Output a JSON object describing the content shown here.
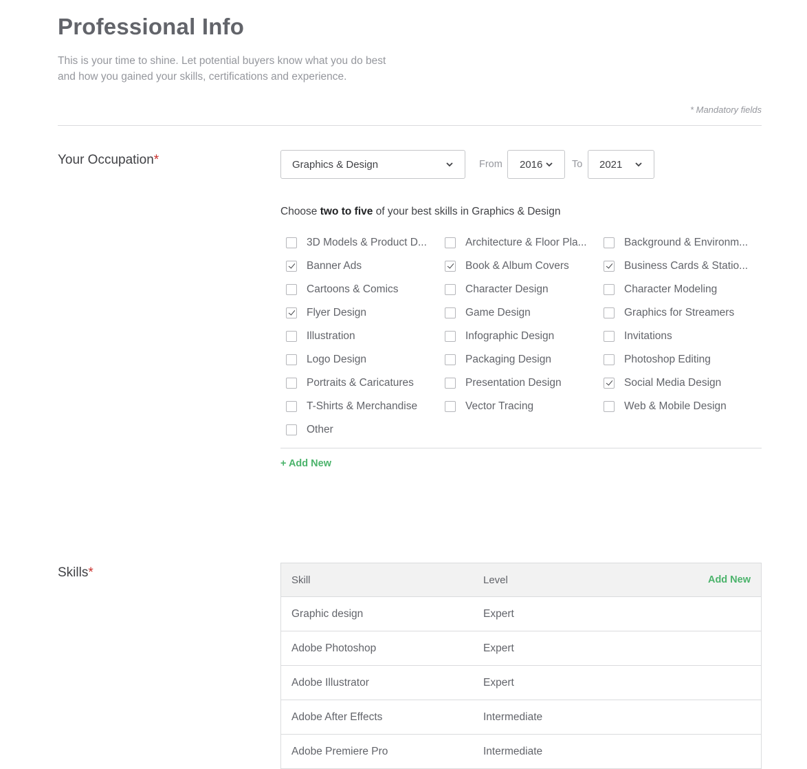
{
  "page": {
    "title": "Professional Info",
    "intro": "This is your time to shine. Let potential buyers know what you do best and how you gained your skills, certifications and experience.",
    "mandatory_note": "* Mandatory fields"
  },
  "occupation": {
    "label": "Your Occupation",
    "required_mark": "*",
    "category": "Graphics & Design",
    "from_label": "From",
    "from_year": "2016",
    "to_label": "To",
    "to_year": "2021",
    "prompt_prefix": "Choose",
    "prompt_bold": "two to five",
    "prompt_suffix": "of your best skills in Graphics & Design",
    "skills": [
      {
        "label": "3D Models & Product D...",
        "checked": false
      },
      {
        "label": "Architecture & Floor Pla...",
        "checked": false
      },
      {
        "label": "Background & Environm...",
        "checked": false
      },
      {
        "label": "Banner Ads",
        "checked": true
      },
      {
        "label": "Book & Album Covers",
        "checked": true
      },
      {
        "label": "Business Cards & Statio...",
        "checked": true
      },
      {
        "label": "Cartoons & Comics",
        "checked": false
      },
      {
        "label": "Character Design",
        "checked": false
      },
      {
        "label": "Character Modeling",
        "checked": false
      },
      {
        "label": "Flyer Design",
        "checked": true
      },
      {
        "label": "Game Design",
        "checked": false
      },
      {
        "label": "Graphics for Streamers",
        "checked": false
      },
      {
        "label": "Illustration",
        "checked": false
      },
      {
        "label": "Infographic Design",
        "checked": false
      },
      {
        "label": "Invitations",
        "checked": false
      },
      {
        "label": "Logo Design",
        "checked": false
      },
      {
        "label": "Packaging Design",
        "checked": false
      },
      {
        "label": "Photoshop Editing",
        "checked": false
      },
      {
        "label": "Portraits & Caricatures",
        "checked": false
      },
      {
        "label": "Presentation Design",
        "checked": false
      },
      {
        "label": "Social Media Design",
        "checked": true
      },
      {
        "label": "T-Shirts & Merchandise",
        "checked": false
      },
      {
        "label": "Vector Tracing",
        "checked": false
      },
      {
        "label": "Web & Mobile Design",
        "checked": false
      },
      {
        "label": "Other",
        "checked": false
      }
    ],
    "add_new": "+ Add New"
  },
  "skills_section": {
    "label": "Skills",
    "required_mark": "*",
    "columns": {
      "skill": "Skill",
      "level": "Level"
    },
    "add_new": "Add New",
    "rows": [
      {
        "skill": "Graphic design",
        "level": "Expert"
      },
      {
        "skill": "Adobe Photoshop",
        "level": "Expert"
      },
      {
        "skill": "Adobe Illustrator",
        "level": "Expert"
      },
      {
        "skill": "Adobe After Effects",
        "level": "Intermediate"
      },
      {
        "skill": "Adobe Premiere Pro",
        "level": "Intermediate"
      }
    ]
  },
  "icons": {
    "dropdown": "chevron-down-icon",
    "checkbox_check": "check-icon"
  }
}
